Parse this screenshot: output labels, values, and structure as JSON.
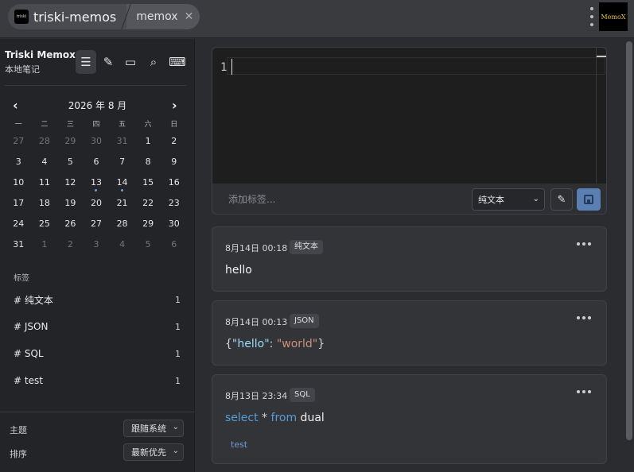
{
  "window": {
    "tab_title": "triski-memos",
    "sub_tab": "memox",
    "app_icon_text": "triski",
    "logo_text": "MemoX"
  },
  "sidebar": {
    "brand": {
      "title": "Triski Memox",
      "subtitle": "本地笔记"
    },
    "toolbar": [
      {
        "name": "list-icon",
        "glyph": "☰"
      },
      {
        "name": "pin-icon",
        "glyph": "✎"
      },
      {
        "name": "archive-icon",
        "glyph": "▭"
      },
      {
        "name": "search-icon",
        "glyph": "⌕"
      },
      {
        "name": "keyboard-icon",
        "glyph": "⌨"
      }
    ],
    "calendar": {
      "title": "2026 年 8 月",
      "prev": "‹",
      "next": "›",
      "weekdays": [
        "一",
        "二",
        "三",
        "四",
        "五",
        "六",
        "日"
      ],
      "weeks": [
        [
          [
            "27",
            "m"
          ],
          [
            "28",
            "m"
          ],
          [
            "29",
            "m"
          ],
          [
            "30",
            "m"
          ],
          [
            "31",
            "m"
          ],
          [
            "1",
            ""
          ],
          [
            "2",
            ""
          ]
        ],
        [
          [
            "3",
            ""
          ],
          [
            "4",
            ""
          ],
          [
            "5",
            ""
          ],
          [
            "6",
            ""
          ],
          [
            "7",
            ""
          ],
          [
            "8",
            ""
          ],
          [
            "9",
            ""
          ]
        ],
        [
          [
            "10",
            ""
          ],
          [
            "11",
            ""
          ],
          [
            "12",
            ""
          ],
          [
            "13",
            "dot"
          ],
          [
            "14",
            "dot"
          ],
          [
            "15",
            ""
          ],
          [
            "16",
            ""
          ]
        ],
        [
          [
            "17",
            ""
          ],
          [
            "18",
            ""
          ],
          [
            "19",
            ""
          ],
          [
            "20",
            ""
          ],
          [
            "21",
            ""
          ],
          [
            "22",
            ""
          ],
          [
            "23",
            ""
          ]
        ],
        [
          [
            "24",
            ""
          ],
          [
            "25",
            ""
          ],
          [
            "26",
            ""
          ],
          [
            "27",
            ""
          ],
          [
            "28",
            ""
          ],
          [
            "29",
            ""
          ],
          [
            "30",
            ""
          ]
        ],
        [
          [
            "31",
            ""
          ],
          [
            "1",
            "m"
          ],
          [
            "2",
            "m"
          ],
          [
            "3",
            "m"
          ],
          [
            "4",
            "m"
          ],
          [
            "5",
            "m"
          ],
          [
            "6",
            "m"
          ]
        ]
      ]
    },
    "tags_title": "标签",
    "tags": [
      {
        "label": "# 纯文本",
        "count": "1"
      },
      {
        "label": "# JSON",
        "count": "1"
      },
      {
        "label": "# SQL",
        "count": "1"
      },
      {
        "label": "# test",
        "count": "1"
      }
    ],
    "settings": {
      "theme_label": "主题",
      "theme_value": "跟随系统",
      "sort_label": "排序",
      "sort_value": "最新优先"
    }
  },
  "editor": {
    "line_number": "1",
    "tag_placeholder": "添加标签...",
    "type_value": "纯文本"
  },
  "memos": [
    {
      "date": "8月14日 00:18",
      "badge": "纯文本",
      "content": "hello"
    },
    {
      "date": "8月14日 00:13",
      "badge": "JSON",
      "content": {
        "open": "{",
        "key": "\"hello\"",
        "colon": ": ",
        "value": "\"world\"",
        "close": "}"
      }
    },
    {
      "date": "8月13日 23:34",
      "badge": "SQL",
      "content": {
        "kw1": "select",
        "star": " * ",
        "kw2": "from",
        "rest": " dual"
      },
      "tag": "test"
    }
  ]
}
